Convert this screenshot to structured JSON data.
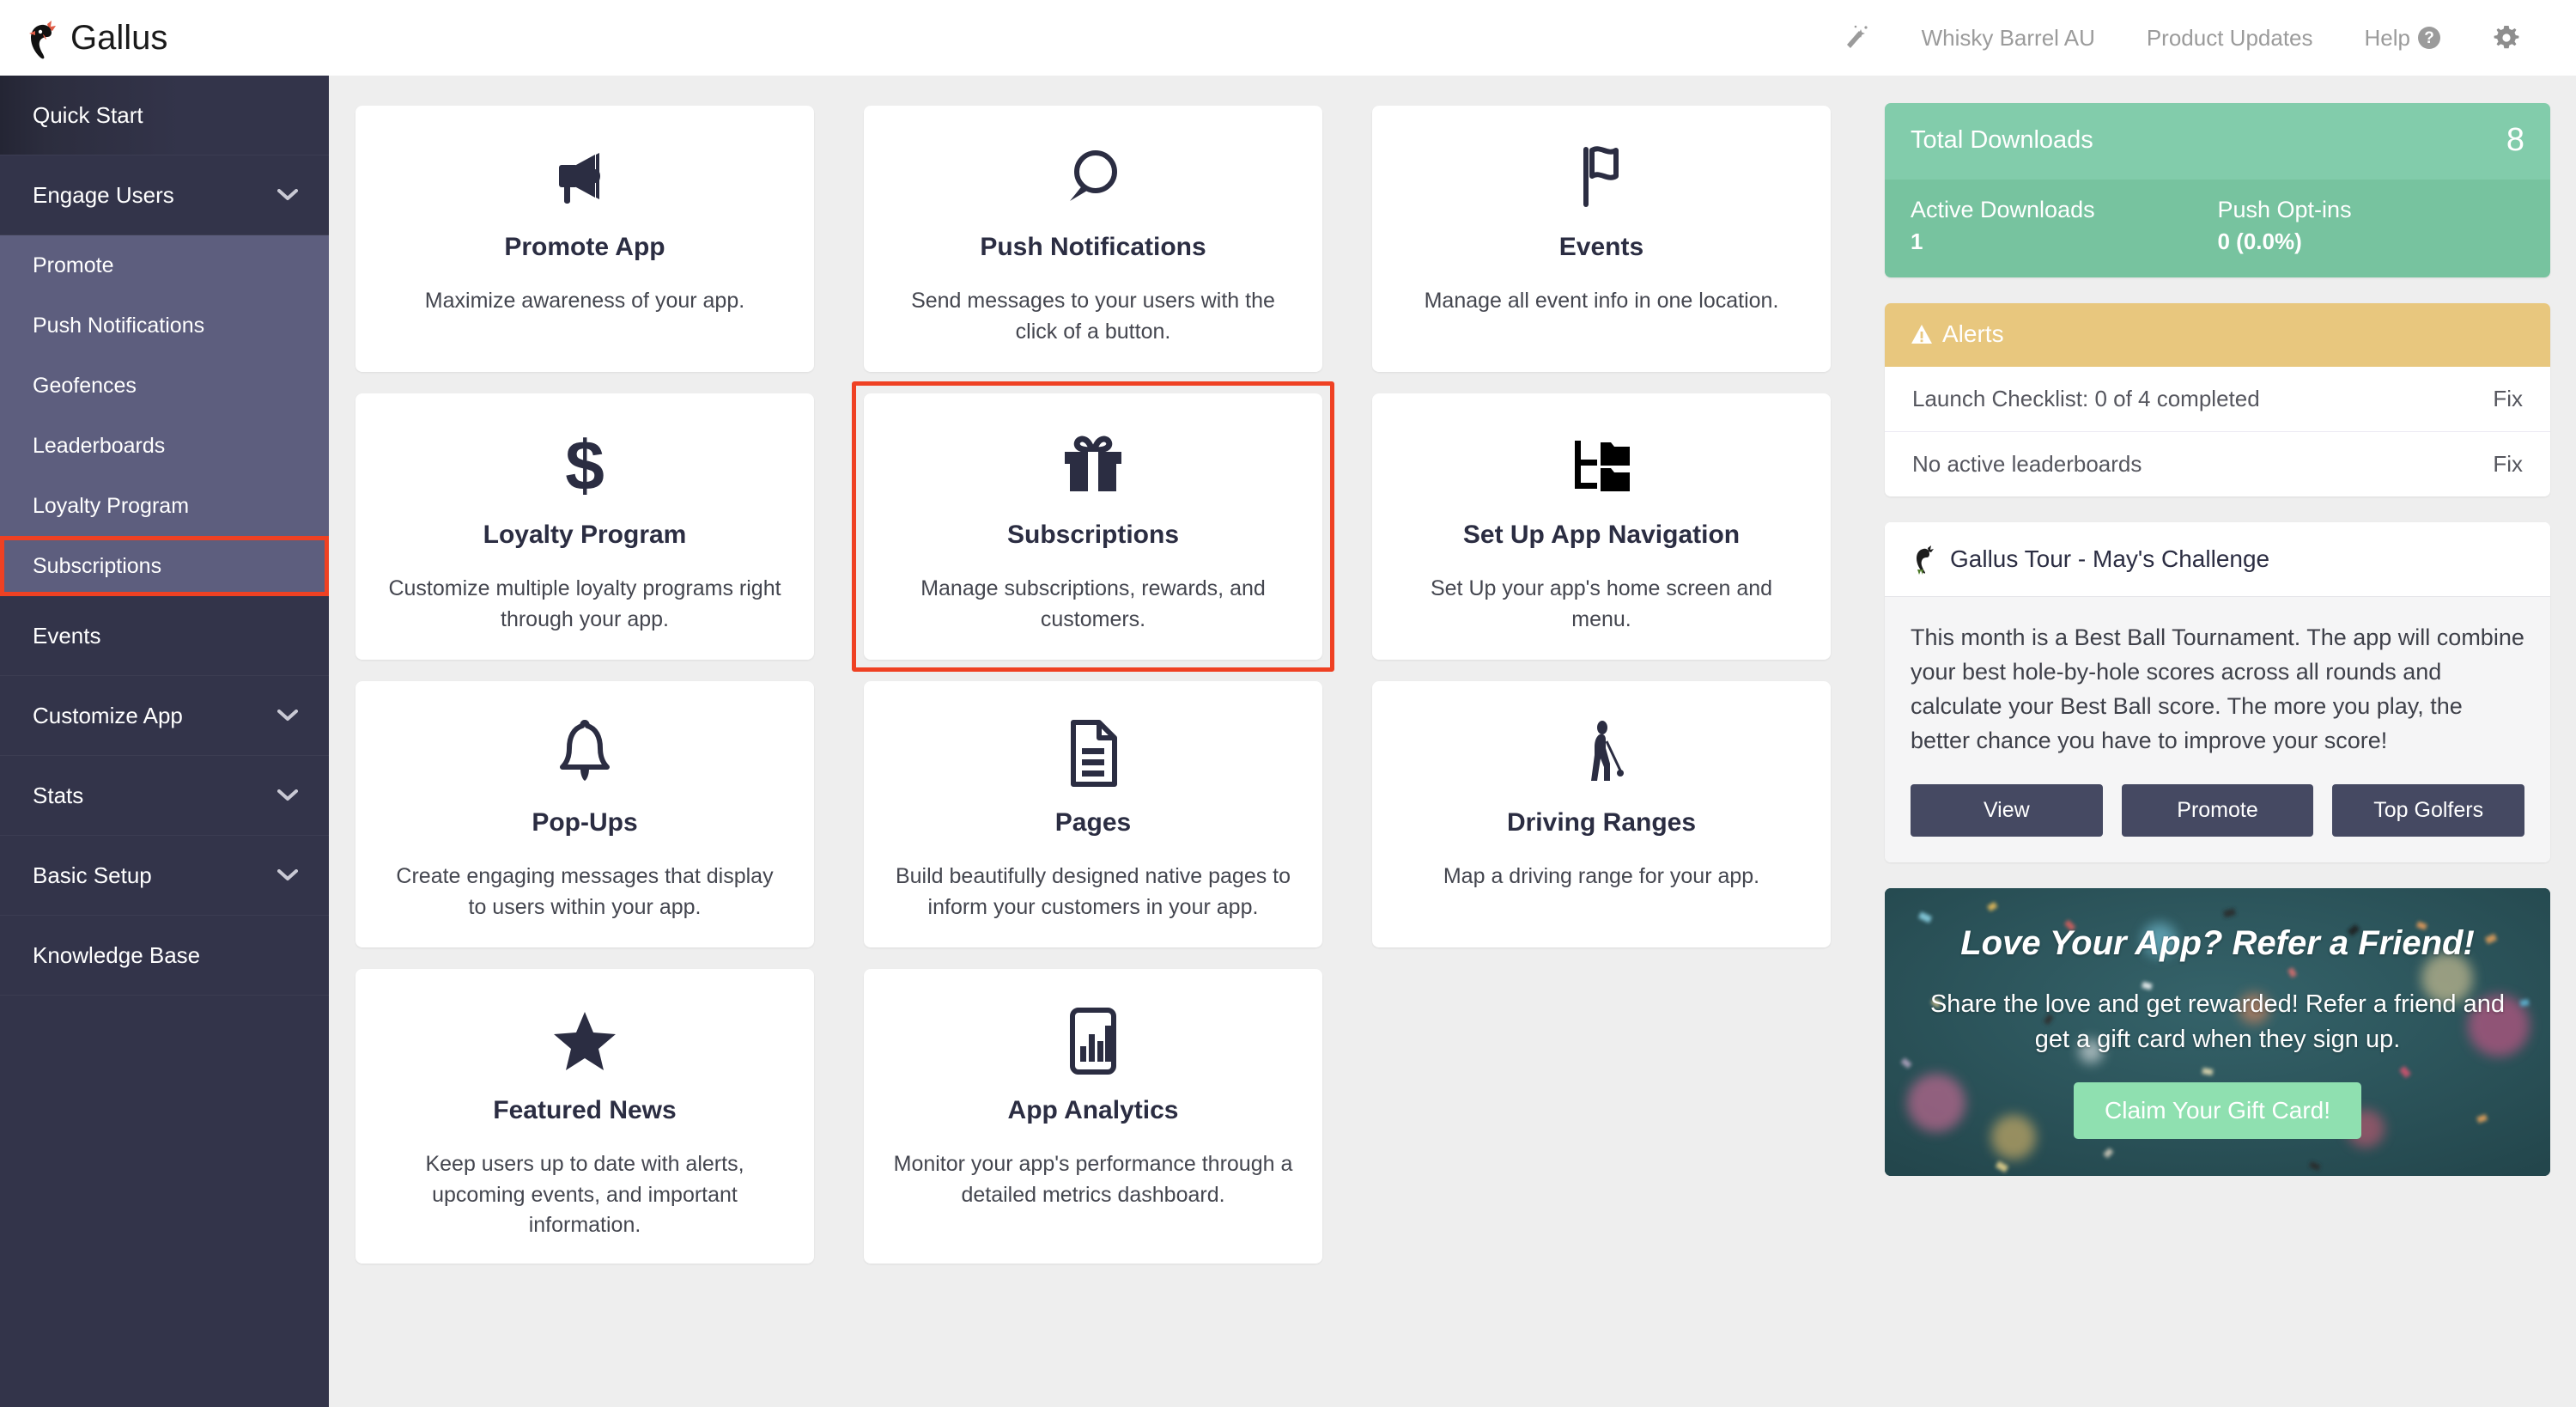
{
  "brand": {
    "name": "Gallus",
    "logo_icon": "rooster-icon"
  },
  "topnav": {
    "wand_icon": "magic-wand-icon",
    "items": [
      {
        "label": "Whisky Barrel AU"
      },
      {
        "label": "Product Updates"
      },
      {
        "label": "Help"
      }
    ],
    "help_badge": "?",
    "gear_icon": "gear-icon"
  },
  "sidebar": {
    "items": [
      {
        "label": "Quick Start",
        "type": "item",
        "active": true
      },
      {
        "label": "Engage Users",
        "type": "group",
        "expanded": true,
        "chevron": "chevron-down-icon"
      },
      {
        "label": "Promote",
        "type": "sub"
      },
      {
        "label": "Push Notifications",
        "type": "sub"
      },
      {
        "label": "Geofences",
        "type": "sub"
      },
      {
        "label": "Leaderboards",
        "type": "sub"
      },
      {
        "label": "Loyalty Program",
        "type": "sub"
      },
      {
        "label": "Subscriptions",
        "type": "sub",
        "highlighted": true
      },
      {
        "label": "Events",
        "type": "item"
      },
      {
        "label": "Customize App",
        "type": "group",
        "chevron": "chevron-down-icon"
      },
      {
        "label": "Stats",
        "type": "group",
        "chevron": "chevron-down-icon"
      },
      {
        "label": "Basic Setup",
        "type": "group",
        "chevron": "chevron-down-icon"
      },
      {
        "label": "Knowledge Base",
        "type": "item"
      }
    ]
  },
  "cards": [
    {
      "icon": "megaphone-icon",
      "title": "Promote App",
      "desc": "Maximize awareness of your app.",
      "highlighted": false
    },
    {
      "icon": "speech-bubble-icon",
      "title": "Push Notifications",
      "desc": "Send messages to your users with the click of a button.",
      "highlighted": false
    },
    {
      "icon": "flag-icon",
      "title": "Events",
      "desc": "Manage all event info in one location.",
      "highlighted": false
    },
    {
      "icon": "dollar-sign-icon",
      "title": "Loyalty Program",
      "desc": "Customize multiple loyalty programs right through your app.",
      "highlighted": false
    },
    {
      "icon": "gift-icon",
      "title": "Subscriptions",
      "desc": "Manage subscriptions, rewards, and customers.",
      "highlighted": true
    },
    {
      "icon": "sitemap-icon",
      "title": "Set Up App Navigation",
      "desc": "Set Up your app's home screen and menu.",
      "highlighted": false
    },
    {
      "icon": "bell-icon",
      "title": "Pop-Ups",
      "desc": "Create engaging messages that display to users within your app.",
      "highlighted": false
    },
    {
      "icon": "document-icon",
      "title": "Pages",
      "desc": "Build beautifully designed native pages to inform your customers in your app.",
      "highlighted": false
    },
    {
      "icon": "golfer-icon",
      "title": "Driving Ranges",
      "desc": "Map a driving range for your app.",
      "highlighted": false
    },
    {
      "icon": "star-icon",
      "title": "Featured News",
      "desc": "Keep users up to date with alerts, upcoming events, and important information.",
      "highlighted": false
    },
    {
      "icon": "bar-chart-phone-icon",
      "title": "App Analytics",
      "desc": "Monitor your app's performance through a detailed metrics dashboard.",
      "highlighted": false
    }
  ],
  "stats": {
    "total_label": "Total Downloads",
    "total_value": "8",
    "active_label": "Active Downloads",
    "active_value": "1",
    "optins_label": "Push Opt-ins",
    "optins_value": "0 (0.0%)",
    "accent_color": "#82ccab"
  },
  "alerts": {
    "header": "Alerts",
    "warn_icon": "warning-triangle-icon",
    "header_color": "#e8c77e",
    "rows": [
      {
        "text": "Launch Checklist: 0 of 4 completed",
        "action": "Fix"
      },
      {
        "text": "No active leaderboards",
        "action": "Fix"
      }
    ]
  },
  "tour": {
    "icon": "rooster-icon",
    "title": "Gallus Tour - May's Challenge",
    "body": "This month is a Best Ball Tournament. The app will combine your best hole-by-hole scores across all rounds and calculate your Best Ball score. The more you play, the better chance you have to improve your score!",
    "buttons": [
      {
        "label": "View"
      },
      {
        "label": "Promote"
      },
      {
        "label": "Top Golfers"
      }
    ]
  },
  "promo": {
    "title": "Love Your App? Refer a Friend!",
    "subtitle": "Share the love and get rewarded! Refer a friend and get a gift card when they sign up.",
    "button": "Claim Your Gift Card!",
    "button_color": "#8fe0b0",
    "background_color": "#2d5257"
  },
  "highlight_color": "#ef4123"
}
